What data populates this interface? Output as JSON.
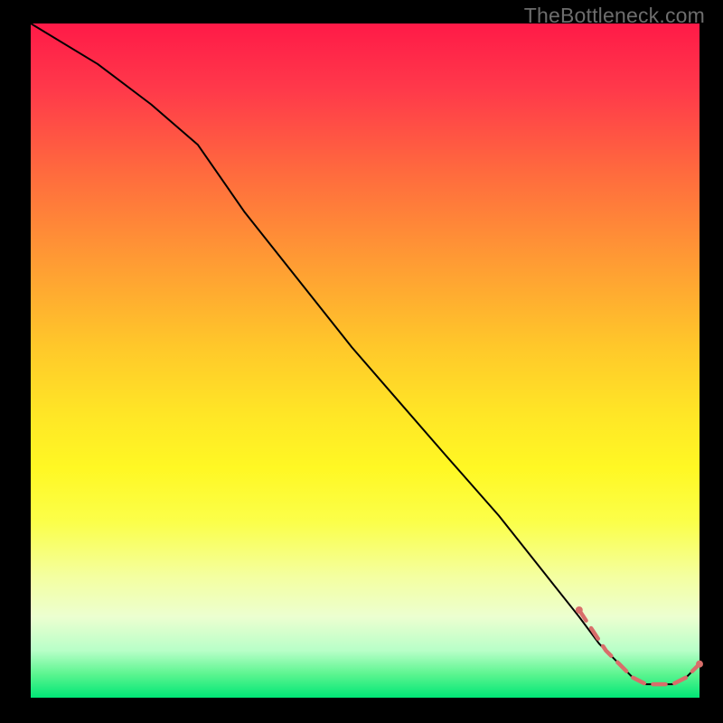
{
  "watermark": "TheBottleneck.com",
  "colors": {
    "frame_bg": "#000000",
    "curve": "#000000",
    "tick_stroke": "#d86e6a",
    "dot": "#d86e6a",
    "gradient_top": "#ff1a48",
    "gradient_bottom": "#00e676",
    "watermark": "#6d6d6d"
  },
  "chart_data": {
    "type": "line",
    "title": "",
    "xlabel": "",
    "ylabel": "",
    "xlim": [
      0,
      100
    ],
    "ylim": [
      0,
      100
    ],
    "grid": false,
    "legend": false,
    "series": [
      {
        "name": "main-curve",
        "x": [
          0,
          10,
          18,
          25,
          32,
          40,
          48,
          55,
          62,
          70,
          78,
          82,
          85,
          88,
          90,
          92,
          94,
          96,
          98,
          100
        ],
        "y": [
          100,
          94,
          88,
          82,
          72,
          62,
          52,
          44,
          36,
          27,
          17,
          12,
          8,
          5,
          3,
          2,
          2,
          2,
          3,
          5
        ]
      },
      {
        "name": "tick-band",
        "x": [
          82,
          84,
          86,
          88,
          90,
          92,
          94,
          96,
          98,
          100
        ],
        "y": [
          13,
          10,
          7,
          5,
          3,
          2,
          2,
          2,
          3,
          5
        ]
      }
    ],
    "background_gradient": {
      "orientation": "vertical",
      "stops": [
        {
          "pos": 0.0,
          "color": "#ff1a48"
        },
        {
          "pos": 0.35,
          "color": "#ff9a34"
        },
        {
          "pos": 0.58,
          "color": "#ffe626"
        },
        {
          "pos": 0.82,
          "color": "#f4ffa0"
        },
        {
          "pos": 0.93,
          "color": "#b8ffc8"
        },
        {
          "pos": 1.0,
          "color": "#00e676"
        }
      ]
    }
  }
}
